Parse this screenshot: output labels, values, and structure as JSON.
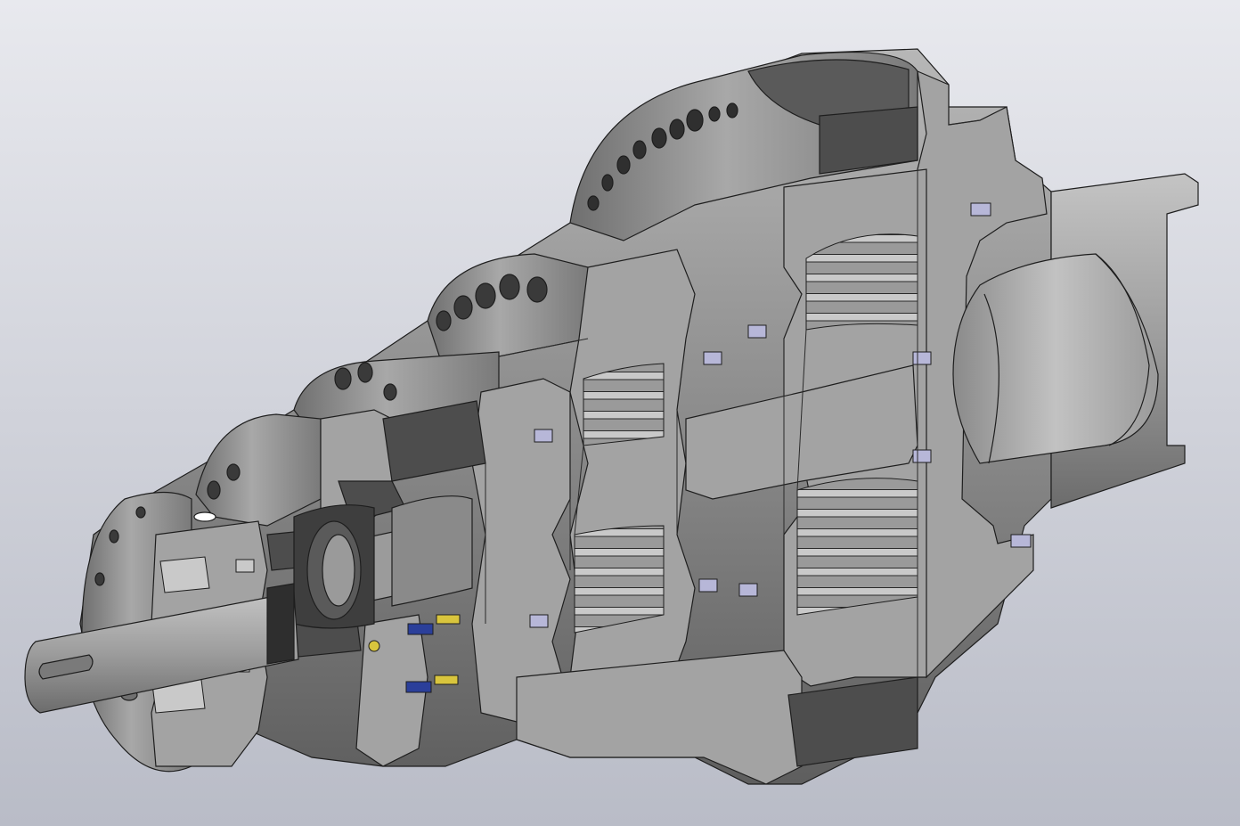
{
  "viewport": {
    "background_top": "#e8e9ee",
    "background_bottom": "#b9bcc7"
  },
  "model": {
    "body_color": "#8f8f8f",
    "section_color": "#a3a3a3",
    "dark_color": "#4d4d4d",
    "edge_color": "#1e1e1e",
    "seal_colors": [
      "#2b3f9a",
      "#d9c53d",
      "#b7b7d8"
    ]
  }
}
